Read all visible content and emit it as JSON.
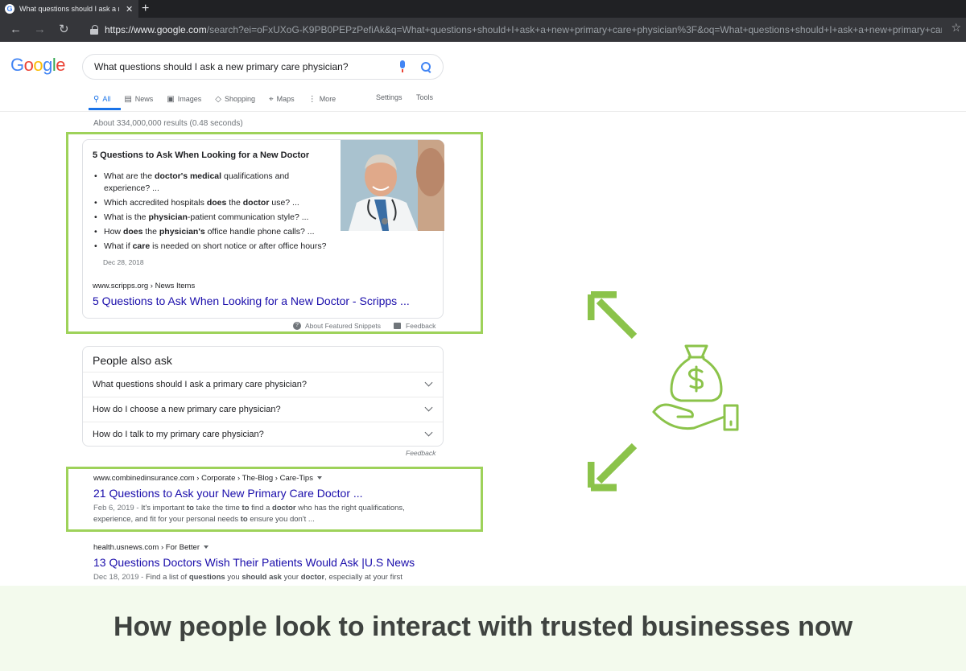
{
  "browser": {
    "tab_title": "What questions should I ask a ne",
    "tab_favicon": "G",
    "url_host": "https://www.google.com",
    "url_path": "/search?ei=oFxUXoG-K9PB0PEPzPefiAk&q=What+questions+should+I+ask+a+new+primary+care+physician%3F&oq=What+questions+should+I+ask+a+new+primary+care+physici..."
  },
  "search": {
    "query": "What questions should I ask a new primary care physician?",
    "tabs": [
      {
        "label": "All",
        "icon": "search-icon"
      },
      {
        "label": "News",
        "icon": "news-icon"
      },
      {
        "label": "Images",
        "icon": "images-icon"
      },
      {
        "label": "Shopping",
        "icon": "shopping-tag-icon"
      },
      {
        "label": "Maps",
        "icon": "map-pin-icon"
      },
      {
        "label": "More",
        "icon": "more-vertical-icon"
      }
    ],
    "settings_label": "Settings",
    "tools_label": "Tools",
    "stats": "About 334,000,000 results (0.48 seconds)"
  },
  "snippet": {
    "title": "5 Questions to Ask When Looking for a New Doctor",
    "items": [
      [
        "What are the ",
        "doctor's medical",
        " qualifications and experience? ..."
      ],
      [
        "Which accredited hospitals ",
        "does",
        " the ",
        "doctor",
        " use? ..."
      ],
      [
        "What is the ",
        "physician",
        "-patient communication style? ..."
      ],
      [
        "How ",
        "does",
        " the ",
        "physician's",
        " office handle phone calls? ..."
      ],
      [
        "What if ",
        "care",
        " is needed on short notice or after office hours?"
      ]
    ],
    "date": "Dec 28, 2018",
    "cite": "www.scripps.org › News Items",
    "link": "5 Questions to Ask When Looking for a New Doctor - Scripps ...",
    "about_label": "About Featured Snippets",
    "feedback_label": "Feedback"
  },
  "paa": {
    "title": "People also ask",
    "questions": [
      "What questions should I ask a primary care physician?",
      "How do I choose a new primary care physician?",
      "How do I talk to my primary care physician?"
    ],
    "feedback_label": "Feedback"
  },
  "results": [
    {
      "cite": "www.combinedinsurance.com › Corporate › The-Blog › Care-Tips",
      "title": "21 Questions to Ask your New Primary Care Doctor ...",
      "date": "Feb 6, 2019",
      "desc_line1": [
        "It's important ",
        "to",
        " take the time ",
        "to",
        " find a ",
        "doctor",
        " who has the right qualifications,"
      ],
      "desc_line2": [
        "experience, and fit for your personal needs ",
        "to",
        " ensure you don't ..."
      ]
    },
    {
      "cite": "health.usnews.com › For Better",
      "title": "13 Questions Doctors Wish Their Patients Would Ask |U.S News",
      "date": "Dec 18, 2019",
      "desc_line1": [
        "Find a list of ",
        "questions",
        " you ",
        "should ask",
        " your ",
        "doctor",
        ", especially at your first"
      ],
      "desc_line2": []
    }
  ],
  "caption": "How people look to interact with trusted businesses now",
  "colors": {
    "accent_green": "#9ed25a",
    "link_blue": "#1a0dab",
    "google_blue": "#1a73e8"
  }
}
